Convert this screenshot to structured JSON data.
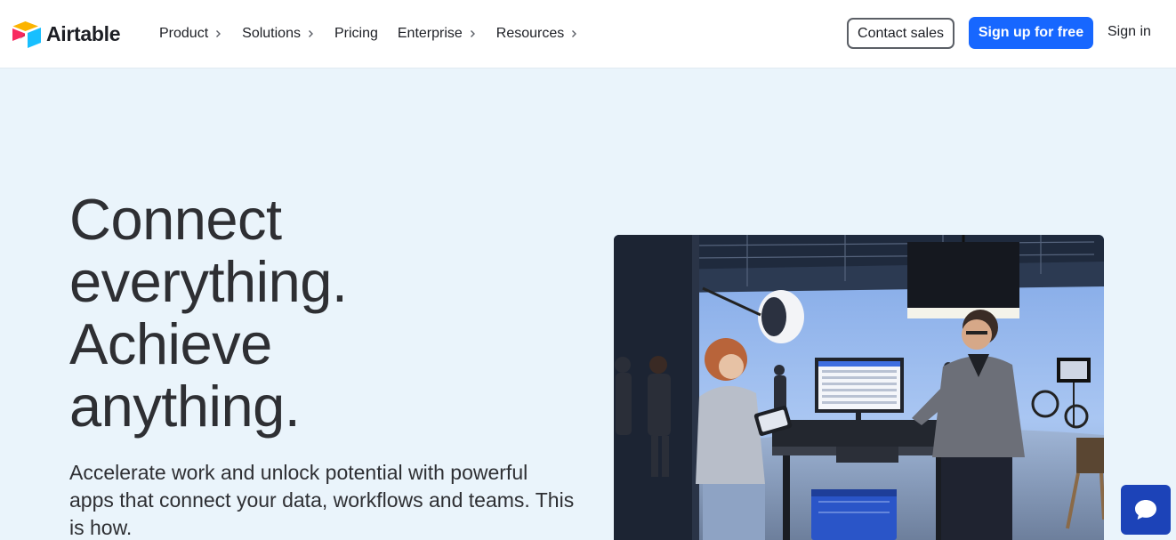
{
  "brand": {
    "name": "Airtable",
    "colors": {
      "red": "#f82b60",
      "yellow": "#fcb400",
      "blue": "#18bfff",
      "primary": "#1767ff"
    }
  },
  "nav": {
    "items": [
      {
        "label": "Product",
        "has_chevron": true
      },
      {
        "label": "Solutions",
        "has_chevron": true
      },
      {
        "label": "Pricing",
        "has_chevron": false
      },
      {
        "label": "Enterprise",
        "has_chevron": true
      },
      {
        "label": "Resources",
        "has_chevron": true
      }
    ]
  },
  "actions": {
    "contact_sales": "Contact sales",
    "sign_up": "Sign up for free",
    "sign_in": "Sign in"
  },
  "hero": {
    "title_lines": [
      "Connect",
      "everything.",
      "Achieve",
      "anything."
    ],
    "subtitle": "Accelerate work and unlock potential with powerful apps that connect your data, workflows and teams. This is how."
  },
  "icons": {
    "chevron": "chevron-right-icon",
    "chat": "chat-bubble-icon"
  }
}
